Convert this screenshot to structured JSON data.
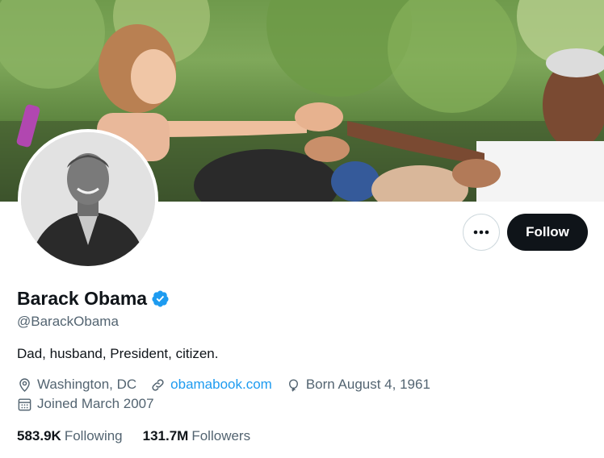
{
  "profile": {
    "name": "Barack Obama",
    "handle": "@BarackObama",
    "bio": "Dad, husband, President, citizen.",
    "location": "Washington, DC",
    "website": "obamabook.com",
    "birthday": "Born August 4, 1961",
    "joined": "Joined March 2007",
    "verified": true
  },
  "actions": {
    "follow_label": "Follow",
    "more_label": "•••"
  },
  "stats": {
    "following_count": "583.9K",
    "following_label": "Following",
    "followers_count": "131.7M",
    "followers_label": "Followers"
  },
  "colors": {
    "verified_blue": "#1d9bf0",
    "link_blue": "#1d9bf0",
    "text_primary": "#0f1419",
    "text_secondary": "#536471",
    "follow_button_bg": "#0f1419"
  },
  "icons": [
    "more-icon",
    "verified-badge-icon",
    "location-pin-icon",
    "link-icon",
    "balloon-icon",
    "calendar-icon"
  ]
}
